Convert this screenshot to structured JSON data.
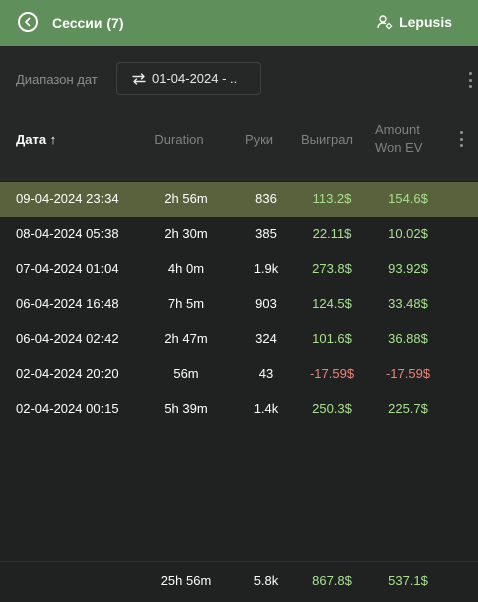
{
  "header": {
    "title": "Сессии (7)",
    "user": "Lepusis",
    "back_icon": "back-arrow-circle-icon",
    "user_icon": "user-settings-icon",
    "bg_color": "#5f8f5a"
  },
  "filter": {
    "label": "Диапазон дат",
    "date_value": "01-04-2024 - ..",
    "swap_icon": "swap-arrows-icon"
  },
  "table": {
    "columns": {
      "date": "Дата",
      "date_sort_icon": "↑",
      "duration": "Duration",
      "hands": "Руки",
      "won": "Выиграл",
      "amount_won_ev_line1": "Amount",
      "amount_won_ev_line2": "Won EV"
    },
    "rows": [
      {
        "date": "09-04-2024 23:34",
        "duration": "2h 56m",
        "hands": "836",
        "won": "113.2$",
        "won_ev": "154.6$",
        "selected": true
      },
      {
        "date": "08-04-2024 05:38",
        "duration": "2h 30m",
        "hands": "385",
        "won": "22.11$",
        "won_ev": "10.02$"
      },
      {
        "date": "07-04-2024 01:04",
        "duration": "4h 0m",
        "hands": "1.9k",
        "won": "273.8$",
        "won_ev": "93.92$"
      },
      {
        "date": "06-04-2024 16:48",
        "duration": "7h 5m",
        "hands": "903",
        "won": "124.5$",
        "won_ev": "33.48$"
      },
      {
        "date": "06-04-2024 02:42",
        "duration": "2h 47m",
        "hands": "324",
        "won": "101.6$",
        "won_ev": "36.88$"
      },
      {
        "date": "02-04-2024 20:20",
        "duration": "56m",
        "hands": "43",
        "won": "-17.59$",
        "won_ev": "-17.59$"
      },
      {
        "date": "02-04-2024 00:15",
        "duration": "5h 39m",
        "hands": "1.4k",
        "won": "250.3$",
        "won_ev": "225.7$"
      }
    ],
    "totals": {
      "duration": "25h 56m",
      "hands": "5.8k",
      "won": "867.8$",
      "won_ev": "537.1$"
    }
  },
  "colors": {
    "positive": "#a6e28c",
    "negative": "#ee8576",
    "selected_row": "#59623d"
  }
}
